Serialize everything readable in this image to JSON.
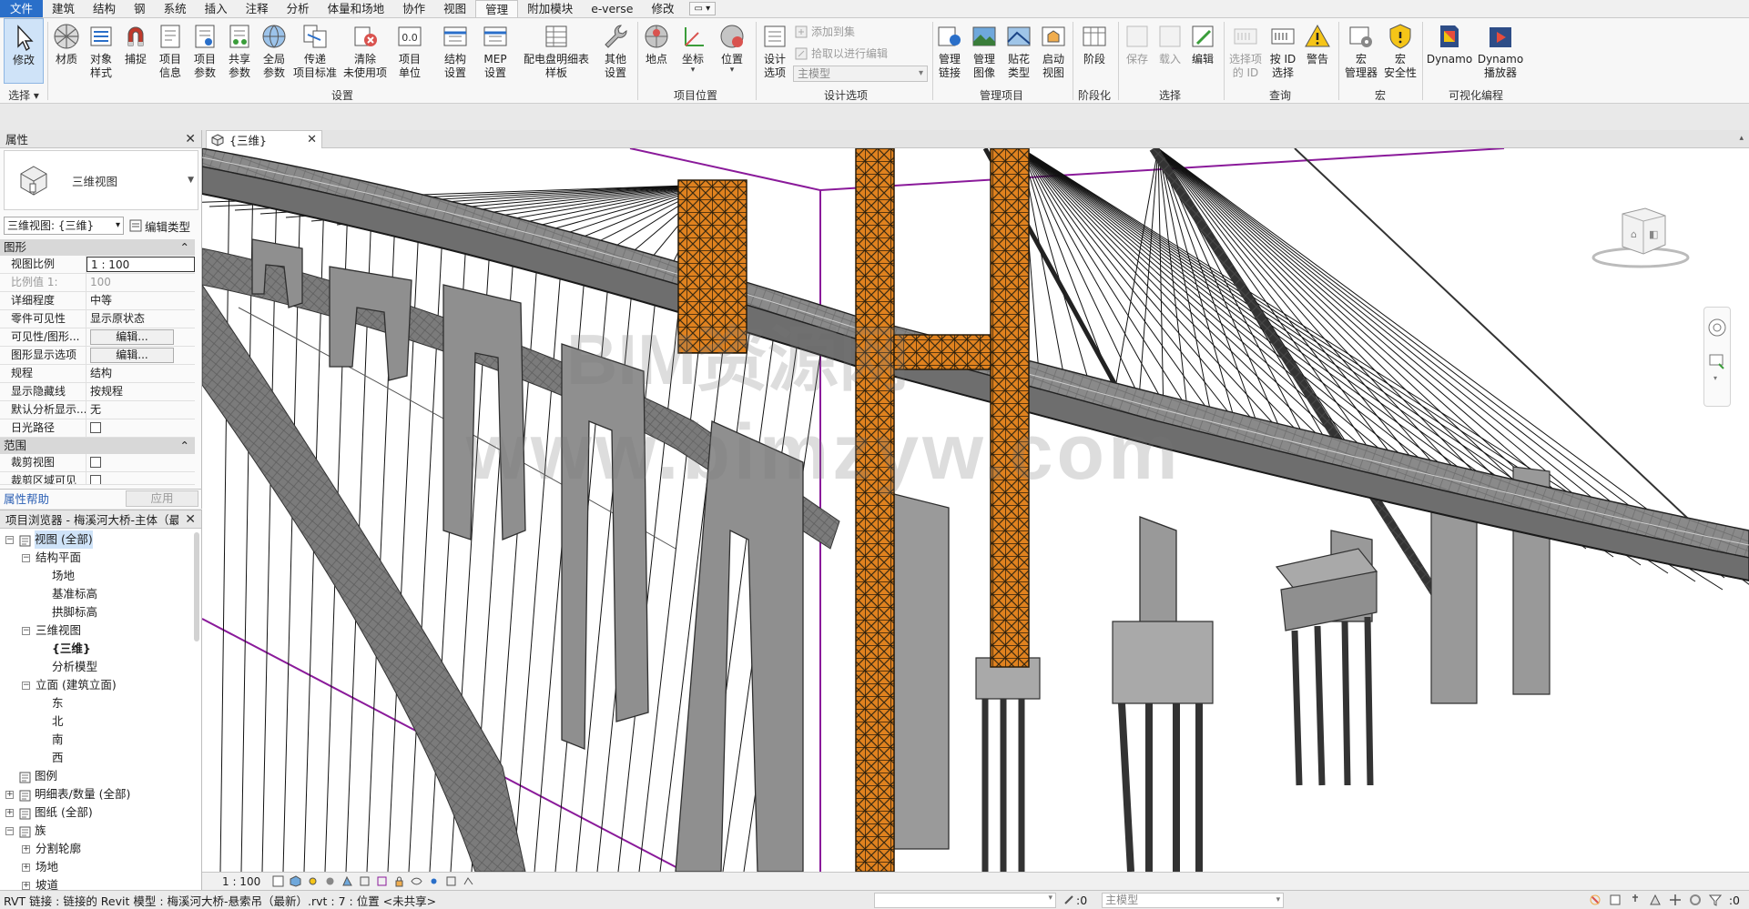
{
  "menu": {
    "tabs": [
      "文件",
      "建筑",
      "结构",
      "钢",
      "系统",
      "插入",
      "注释",
      "分析",
      "体量和场地",
      "协作",
      "视图",
      "管理",
      "附加模块",
      "e-verse",
      "修改"
    ],
    "active": "管理"
  },
  "ribbon": {
    "select": {
      "label": "修改",
      "panel": "选择"
    },
    "buttons": {
      "materials": "材质",
      "object_styles_1": "对象",
      "object_styles_2": "样式",
      "snaps": "捕捉",
      "project_info_1": "项目",
      "project_info_2": "信息",
      "project_params_1": "项目",
      "project_params_2": "参数",
      "shared_params_1": "共享",
      "shared_params_2": "参数",
      "global_params_1": "全局",
      "global_params_2": "参数",
      "transfer_1": "传递",
      "transfer_2": "项目标准",
      "purge_1": "清除",
      "purge_2": "未使用项",
      "units_1": "项目",
      "units_2": "单位",
      "struct_settings_1": "结构",
      "struct_settings_2": "设置",
      "mep_1": "MEP",
      "mep_2": "设置",
      "panel_schedule_1": "配电盘明细表",
      "panel_schedule_2": "样板",
      "other_settings_1": "其他",
      "other_settings_2": "设置",
      "location": "地点",
      "coordinates": "坐标",
      "position": "位置",
      "design_options_1": "设计",
      "design_options_2": "选项",
      "add_to_set": "添加到集",
      "pick_to_edit": "拾取以进行编辑",
      "main_model": "主模型",
      "manage_links_1": "管理",
      "manage_links_2": "链接",
      "manage_images_1": "管理",
      "manage_images_2": "图像",
      "decal_types_1": "贴花",
      "decal_types_2": "类型",
      "starting_view_1": "启动",
      "starting_view_2": "视图",
      "phases": "阶段",
      "save": "保存",
      "load": "载入",
      "edit": "编辑",
      "select_ids_1": "选择项",
      "select_ids_2": "的 ID",
      "select_by_id_1": "按 ID",
      "select_by_id_2": "选择",
      "warnings": "警告",
      "macro_manager_1": "宏",
      "macro_manager_2": "管理器",
      "macro_security_1": "宏",
      "macro_security_2": "安全性",
      "dynamo": "Dynamo",
      "dynamo_player_1": "Dynamo",
      "dynamo_player_2": "播放器"
    },
    "panels": {
      "settings": "设置",
      "project_location": "项目位置",
      "design_options": "设计选项",
      "manage_project": "管理项目",
      "phasing": "阶段化",
      "selection": "选择",
      "inquiry": "查询",
      "macros": "宏",
      "visual_programming": "可视化编程"
    }
  },
  "properties": {
    "title": "属性",
    "type_name": "三维视图",
    "filter": "三维视图: {三维}",
    "edit_type": "编辑类型",
    "groups": {
      "graphics": "图形",
      "extents": "范围"
    },
    "rows": [
      {
        "key": "视图比例",
        "value": "1 : 100"
      },
      {
        "key": "比例值 1:",
        "value": "100"
      },
      {
        "key": "详细程度",
        "value": "中等"
      },
      {
        "key": "零件可见性",
        "value": "显示原状态"
      },
      {
        "key": "可见性/图形...",
        "value": "编辑..."
      },
      {
        "key": "图形显示选项",
        "value": "编辑..."
      },
      {
        "key": "规程",
        "value": "结构"
      },
      {
        "key": "显示隐藏线",
        "value": "按规程"
      },
      {
        "key": "默认分析显示...",
        "value": "无"
      },
      {
        "key": "日光路径",
        "value": ""
      }
    ],
    "extents_rows": [
      {
        "key": "裁剪视图",
        "value": ""
      },
      {
        "key": "裁剪区域可见",
        "value": ""
      }
    ],
    "help": "属性帮助",
    "apply": "应用"
  },
  "browser": {
    "title": "项目浏览器 - 梅溪河大桥-主体（最...",
    "items": [
      {
        "label": "视图 (全部)"
      },
      {
        "label": "结构平面"
      },
      {
        "label": "场地"
      },
      {
        "label": "基准标高"
      },
      {
        "label": "拱脚标高"
      },
      {
        "label": "三维视图"
      },
      {
        "label": "{三维}"
      },
      {
        "label": "分析模型"
      },
      {
        "label": "立面 (建筑立面)"
      },
      {
        "label": "东"
      },
      {
        "label": "北"
      },
      {
        "label": "南"
      },
      {
        "label": "西"
      },
      {
        "label": "图例"
      },
      {
        "label": "明细表/数量 (全部)"
      },
      {
        "label": "图纸 (全部)"
      },
      {
        "label": "族"
      },
      {
        "label": "分割轮廓"
      },
      {
        "label": "场地"
      },
      {
        "label": "坡道"
      }
    ]
  },
  "view": {
    "tab": "{三维}",
    "scale": "1 : 100",
    "watermark_1": "BIM资源网",
    "watermark_2": "www.bimzyw.com"
  },
  "status": {
    "text": "RVT 链接 : 链接的 Revit 模型 : 梅溪河大桥-悬索吊（最新）.rvt : 7 : 位置 <未共享>",
    "zero": ":0",
    "model": "主模型",
    "filter_zero": ":0"
  },
  "colors": {
    "accent": "#2a6fc9",
    "scaffold": "#e0821f",
    "concrete": "#8f8f8f",
    "crop_line": "#8a1a9a"
  }
}
